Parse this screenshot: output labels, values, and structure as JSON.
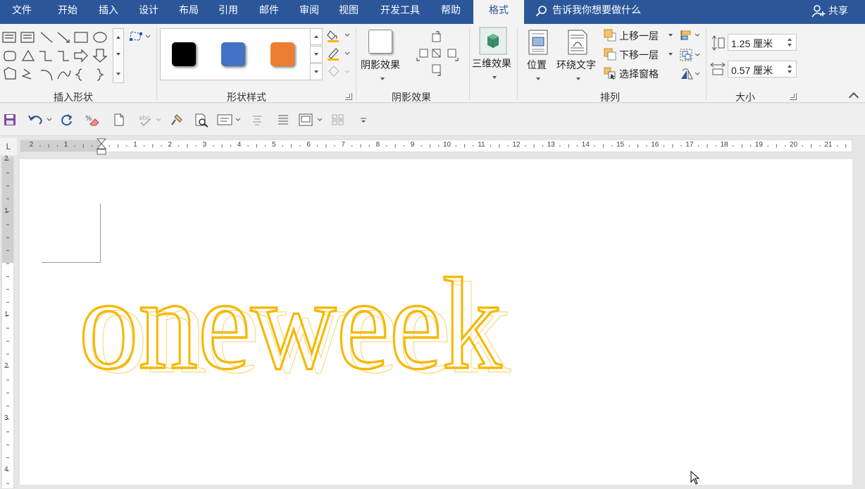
{
  "tabs": [
    {
      "label": "文件"
    },
    {
      "label": "开始"
    },
    {
      "label": "插入"
    },
    {
      "label": "设计"
    },
    {
      "label": "布局"
    },
    {
      "label": "引用"
    },
    {
      "label": "邮件"
    },
    {
      "label": "审阅"
    },
    {
      "label": "视图"
    },
    {
      "label": "开发工具"
    },
    {
      "label": "帮助"
    },
    {
      "label": "格式"
    }
  ],
  "active_tab": "格式",
  "tell_me": "告诉我你想要做什么",
  "share": "共享",
  "ribbon": {
    "groups": {
      "insert_shapes": "插入形状",
      "shape_styles": "形状样式",
      "shadow_effects": "阴影效果",
      "arrange": "排列",
      "size": "大小"
    },
    "shadow_effects_btn": "阴影效果",
    "three_d_btn": "三维效果",
    "position_btn": "位置",
    "wrap_text_btn": "环绕文字",
    "bring_forward": "上移一层",
    "send_backward": "下移一层",
    "selection_pane": "选择窗格",
    "height_value": "1.25 厘米",
    "width_value": "0.57 厘米",
    "style_swatches": [
      "#000000",
      "#4472c4",
      "#ed7d31"
    ]
  },
  "ruler": {
    "h_numbers": [
      "2",
      "1",
      "1",
      "2",
      "3",
      "4",
      "5",
      "6",
      "7",
      "8",
      "9",
      "10",
      "11",
      "12",
      "13",
      "14",
      "15",
      "16",
      "17",
      "18",
      "19",
      "20",
      "21"
    ],
    "v_numbers": [
      "2",
      "1",
      "1",
      "2",
      "3",
      "4"
    ],
    "corner": "L"
  },
  "document": {
    "wordart_text": "oneweek",
    "wordart_color": "#f5b800"
  }
}
